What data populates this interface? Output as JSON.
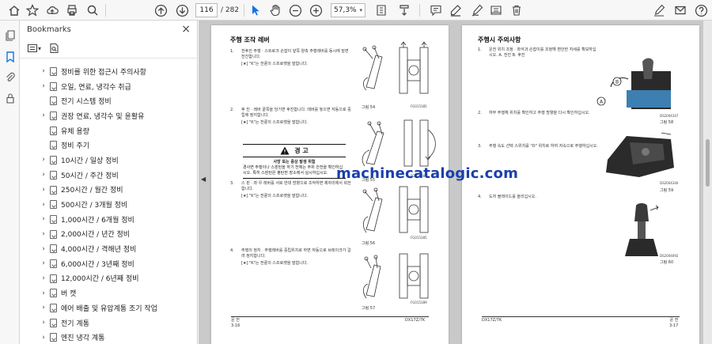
{
  "toolbar": {
    "page_current": "116",
    "page_total": "/ 282",
    "zoom": "57,3%"
  },
  "bookmarks": {
    "title": "Bookmarks",
    "close": "×",
    "items": [
      {
        "label": "정비를 위한 접근시 주의사항",
        "expandable": true
      },
      {
        "label": "오일, 연료, 냉각수 취급",
        "expandable": true
      },
      {
        "label": "전기 시스템 정비",
        "expandable": false
      },
      {
        "label": "권장 연료, 냉각수 및 윤활유",
        "expandable": true
      },
      {
        "label": "유체 용량",
        "expandable": false
      },
      {
        "label": "정비 주기",
        "expandable": false
      },
      {
        "label": "10시간 / 일상 정비",
        "expandable": true
      },
      {
        "label": "50시간 / 주간 정비",
        "expandable": true
      },
      {
        "label": "250시간 / 월간 정비",
        "expandable": true
      },
      {
        "label": "500시간 / 3개월 정비",
        "expandable": true
      },
      {
        "label": "1,000시간 / 6개월 정비",
        "expandable": true
      },
      {
        "label": "2,000시간 / 년간 정비",
        "expandable": true
      },
      {
        "label": "4,000시간 / 격해년 정비",
        "expandable": true
      },
      {
        "label": "6,000시간 / 3년째 정비",
        "expandable": true
      },
      {
        "label": "12,000시간 / 6년째 정비",
        "expandable": true
      },
      {
        "label": "버 캣",
        "expandable": true
      },
      {
        "label": "에어 배출 및 유압계통 조기 작업",
        "expandable": true
      },
      {
        "label": "전기 계통",
        "expandable": true
      },
      {
        "label": "엔진 냉각 계통",
        "expandable": true
      }
    ]
  },
  "left_page": {
    "title": "주행 조작 레버",
    "steps": [
      {
        "num": "1.",
        "text": "전후진 주행 · 스트로크 손잡이 앞쪽 양측 주행레버를 동시에 밀면 전진합니다.",
        "note": "[★] \"K\"는 전륜의 스프로켓을 말합니다."
      },
      {
        "num": "2.",
        "text": "후 진 · 레버 끝쪽을 당기면 후진합니다. 레버를 놓으면 자동으로 중립에 정지합니다.",
        "note": "[★] \"K\"는 전륜의 스프로켓을 말합니다."
      },
      {
        "num": "3.",
        "text": "스 핀 · 좌·우 레버를 서로 반대 방향으로 조작하면 제자리에서 회전합니다.",
        "note": "[★] \"K\"는 전륜의 스프로켓을 말합니다."
      },
      {
        "num": "4.",
        "text": "주행의 정지 · 주행레버를 중립위치로 하면 자동으로 브레이크가 걸려 정지합니다.",
        "note": "[★] \"K\"는 전륜의 스프로켓을 말합니다."
      }
    ],
    "warning": {
      "title": "경 고",
      "subtitle": "사망 또는 중상 발생 위험",
      "body": "경사면 주행이나 스핀턴을 하기 전에는 주위 안전을 확인하십시오. 특히 스핀턴은 평탄한 장소에서 실시하십시오."
    },
    "figures": [
      {
        "caption": "그림 54",
        "code": "FG015385"
      },
      {
        "caption": "그림 55",
        "code": "FG016087"
      },
      {
        "caption": "그림 56",
        "code": "FG015385"
      },
      {
        "caption": "그림 57",
        "code": "FG015389"
      }
    ],
    "footer_left": "운 전\n3-16",
    "footer_right": "DX17Z/7K"
  },
  "right_page": {
    "title": "주행시 주의사항",
    "steps": [
      {
        "num": "1.",
        "text": "운전 위치 조정 · 좌석과 손잡이를 조정해 편안한 자세를 확보하십시오. A. 전진 B. 후진",
        "note": ""
      },
      {
        "num": "2.",
        "text": "하부 주행체 위치를 확인하고 주행 방향을 다시 확인하십시오.",
        "note": ""
      },
      {
        "num": "3.",
        "text": "주행 속도 선택 스위치를 \"O\" 위치로 하여 저속으로 주행하십시오.",
        "note": ""
      },
      {
        "num": "4.",
        "text": "도저 블레이드를 올리십시오.",
        "note": ""
      }
    ],
    "figures": [
      {
        "caption": "그림 58",
        "code": "DS2004347"
      },
      {
        "caption": "그림 59",
        "code": "DS2004340"
      },
      {
        "caption": "그림 60",
        "code": "DS2004092"
      }
    ],
    "footer_left": "DX17Z/7K",
    "footer_right": "운 전\n3-17"
  },
  "watermark": "machinecatalogic.com"
}
